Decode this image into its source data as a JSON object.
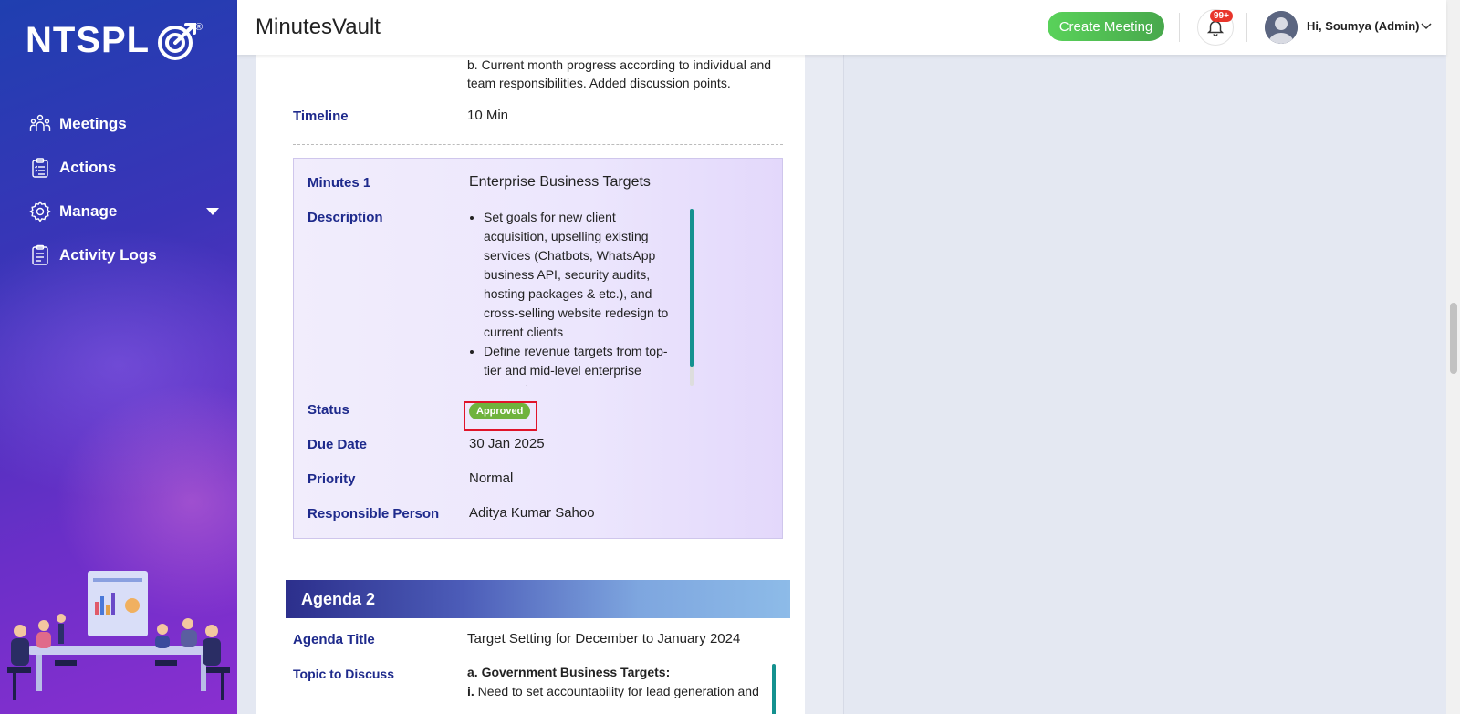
{
  "sidebar": {
    "logo_text": "NTSPL",
    "logo_reg": "®",
    "items": [
      {
        "label": "Meetings",
        "icon": "meetings-icon"
      },
      {
        "label": "Actions",
        "icon": "clipboard-icon"
      },
      {
        "label": "Manage",
        "icon": "gear-icon"
      },
      {
        "label": "Activity Logs",
        "icon": "activity-log-icon"
      }
    ]
  },
  "header": {
    "title": "MinutesVault",
    "create_label": "Create Meeting",
    "notif_count": "99+",
    "user_greeting": "Hi, Soumya (Admin)"
  },
  "agenda1": {
    "topic_tail": "b. Current month progress according to individual and team responsibilities. Added discussion points.",
    "timeline_label": "Timeline",
    "timeline_value": "10 Min"
  },
  "minutes": {
    "title_label": "Minutes 1",
    "title_value": "Enterprise Business Targets",
    "description_label": "Description",
    "description_items": [
      "Set goals for new client acquisition, upselling existing services (Chatbots, WhatsApp business API, security audits, hosting packages & etc.), and cross-selling website redesign to current clients",
      " Define revenue targets from top-tier and mid-level enterprise accounts."
    ],
    "status_label": "Status",
    "status_value": "Approved",
    "due_label": "Due Date",
    "due_value": "30 Jan 2025",
    "priority_label": "Priority",
    "priority_value": "Normal",
    "responsible_label": "Responsible Person",
    "responsible_value": "Aditya Kumar Sahoo"
  },
  "agenda2": {
    "heading": "Agenda 2",
    "title_label": "Agenda Title",
    "title_value": "Target Setting for December to January 2024",
    "topic_label": "Topic to Discuss",
    "topic_heading": "a. Government Business Targets:",
    "topic_line_prefix": "i.",
    "topic_line": "Need to set accountability for lead generation and"
  },
  "colors": {
    "label": "#1e2a8c",
    "status_approved": "#6fb33d",
    "create_button": "#4fbf52",
    "highlight_frame": "#e0142a"
  }
}
